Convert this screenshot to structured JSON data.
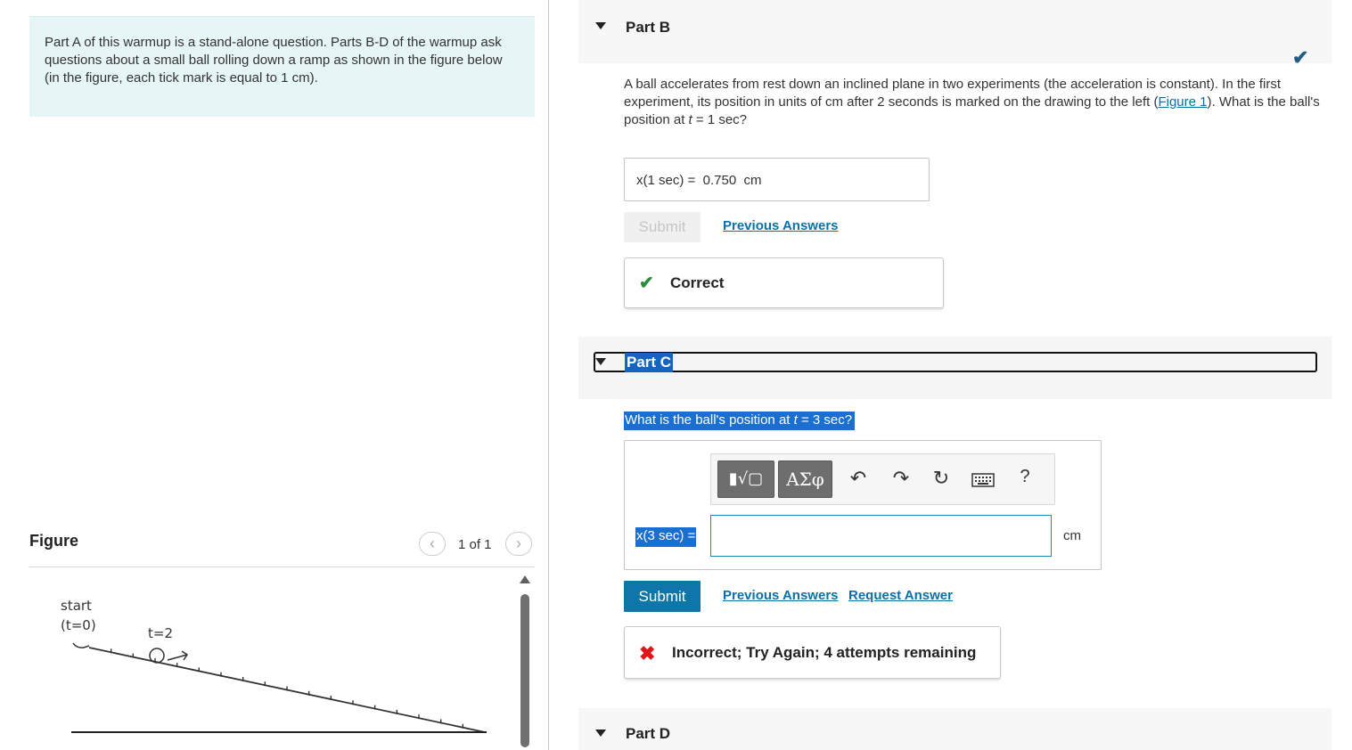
{
  "intro": {
    "text": "Part A of this warmup is a stand-alone question. Parts B-D of the warmup ask questions about a small ball rolling down a ramp as shown in the figure below (in the figure, each tick mark is equal to 1 cm)."
  },
  "figure": {
    "title": "Figure",
    "pager": "1 of 1",
    "prev_icon": "chevron-left-icon",
    "next_icon": "chevron-right-icon",
    "label_start": "start",
    "label_t0": "(t=0)",
    "label_t2": "t=2"
  },
  "part_b": {
    "title": "Part B",
    "question_pre": "A ball accelerates from rest down an inclined plane in two experiments (the acceleration is constant). In the first experiment, its position in units of cm after 2 seconds is marked on the drawing to the left (",
    "figure_link": "Figure 1",
    "question_mid": "). What is the ball's position at ",
    "question_var": "t",
    "question_post": " = 1 sec?",
    "answer_label": "x(1 sec) =",
    "answer_value": "0.750",
    "answer_unit": "cm",
    "submit_label": "Submit",
    "previous_answers": "Previous Answers",
    "feedback": "Correct",
    "feedback_color": "#2e8b3a"
  },
  "part_c": {
    "title": "Part C",
    "question_pre": "What is the ball's position at ",
    "question_var": "t",
    "question_post": " = 3 sec?",
    "toolbar": {
      "template_label": "▮√▢",
      "greek_label": "ΑΣφ",
      "undo_icon": "undo-icon",
      "redo_icon": "redo-icon",
      "reset_icon": "reset-icon",
      "keyboard_icon": "keyboard-icon",
      "help_label": "?"
    },
    "input_label": "x(3 sec) =",
    "input_unit": "cm",
    "submit_label": "Submit",
    "previous_answers": "Previous Answers",
    "request_answer": "Request Answer",
    "feedback": "Incorrect; Try Again; 4 attempts remaining",
    "feedback_color": "#e0151b"
  },
  "part_d": {
    "title": "Part D"
  }
}
